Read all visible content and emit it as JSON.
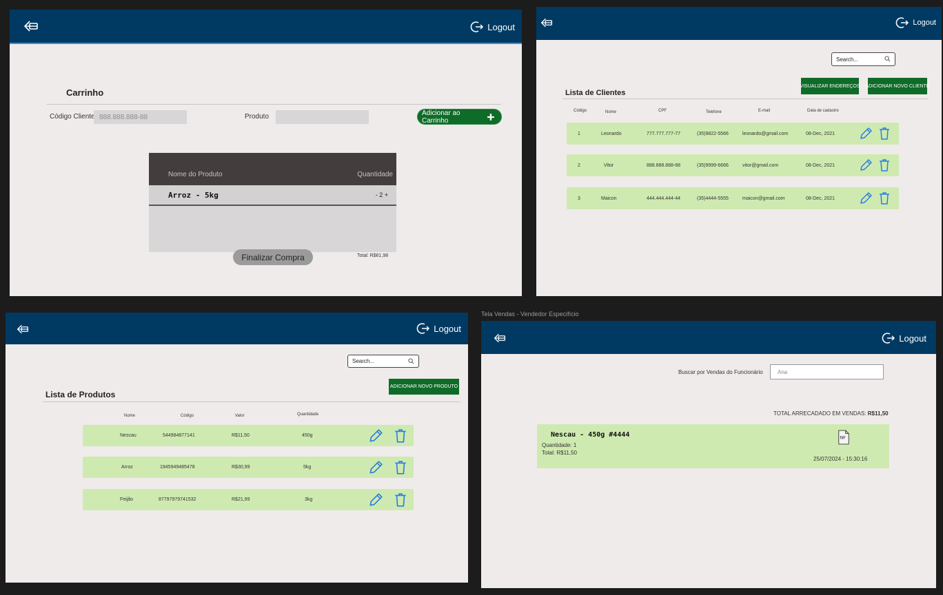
{
  "common": {
    "logout_label": "Logout"
  },
  "cart_screen": {
    "title": "Carrinho",
    "client_code_label": "Código Cliente",
    "client_code_placeholder": "888.888.888-88",
    "product_label": "Produto",
    "product_value": "",
    "add_button_label": "Adicionar ao Carrinho",
    "table_headers": {
      "product": "Nome do Produto",
      "quantity": "Quantidade"
    },
    "items": [
      {
        "name": "Arroz - 5kg",
        "quantity": "- 2 +"
      }
    ],
    "finalize_button_label": "Finalizar Compra",
    "total_text": "Total: R$61,98"
  },
  "clients_screen": {
    "title": "Lista de Clientes",
    "search_placeholder": "Search...",
    "view_addresses_button": "VISUALIZAR ENDEREÇOS",
    "add_client_button": "ADICIONAR NOVO CLIENTE",
    "headers": [
      "Código",
      "Nome",
      "CPF",
      "Telefone",
      "E-mail",
      "Data de cadastro"
    ],
    "rows": [
      [
        "1",
        "Leonardo",
        "777.777.777-77",
        "(35)9822-5566",
        "leonardo@gmail.com",
        "08-Dec, 2021"
      ],
      [
        "2",
        "Vitor",
        "888.888.888-88",
        "(35)9999-6666",
        "vitor@gmail.com",
        "08-Dec, 2021"
      ],
      [
        "3",
        "Maicon",
        "444.444.444-44",
        "(35)4444-5555",
        "maicon@gmail.com",
        "08-Dec, 2021"
      ]
    ]
  },
  "products_screen": {
    "title": "Lista de Produtos",
    "search_placeholder": "Search...",
    "add_product_button": "ADICIONAR NOVO PRODUTO",
    "headers": [
      "Nome",
      "Código",
      "Valor",
      "Quantidade"
    ],
    "rows": [
      [
        "Nescau",
        "544984877141",
        "R$11,50",
        "450g"
      ],
      [
        "Arroz",
        "1945949485478",
        "R$30,99",
        "5kg"
      ],
      [
        "Feijão",
        "87797979741532",
        "R$21,99",
        "3kg"
      ]
    ]
  },
  "sales_screen": {
    "caption": "Tela Vendas - Vendedor Especifício",
    "search_label": "Buscar por Vendas do Funcionário",
    "search_value": "Ana",
    "total_label": "TOTAL ARRECADADO EM VENDAS:",
    "total_value": "R$11,50",
    "sale": {
      "title": "Nescau - 450g #4444",
      "quantity": "Quantidade: 1",
      "total": "Total: R$11,50",
      "datetime": "25/07/2024 - 15:30:16",
      "invoice_icon_text": "NF"
    }
  },
  "colors": {
    "header": "#003a63",
    "row": "#cfeab1",
    "button": "#0f6b28",
    "background": "#efebeb",
    "icon": "#2a7ee0"
  }
}
